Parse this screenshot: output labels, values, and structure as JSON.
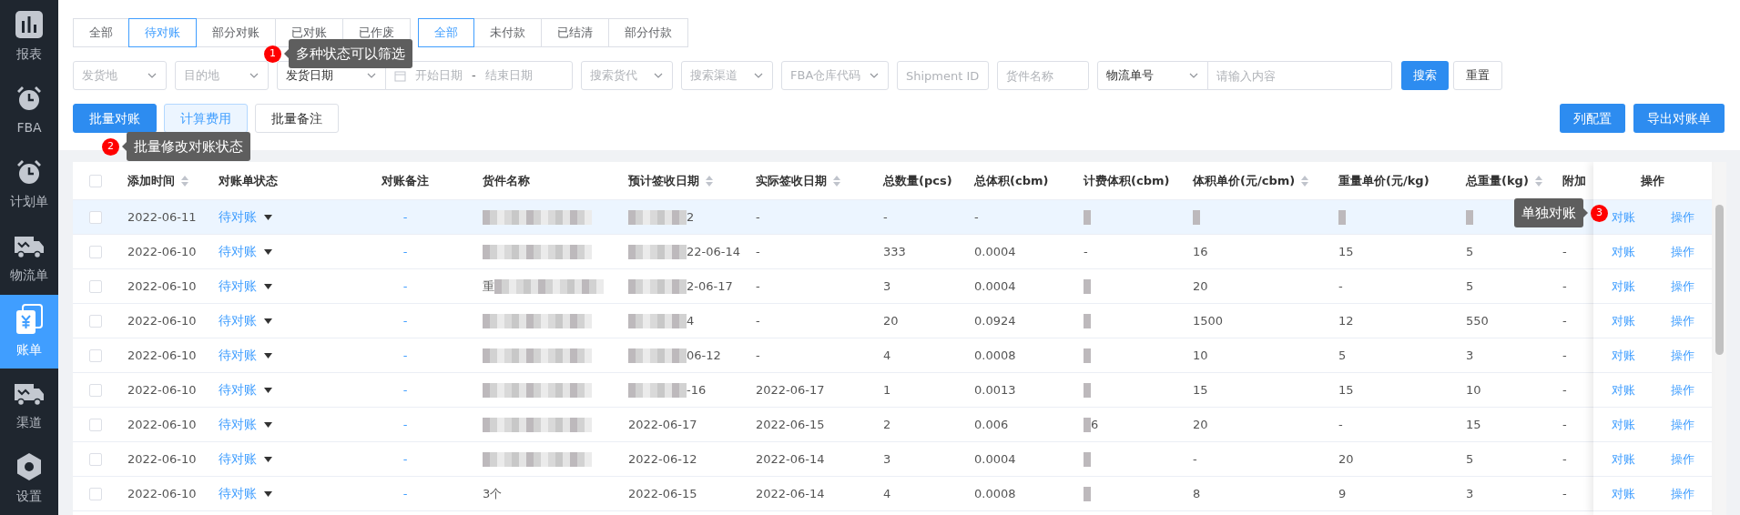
{
  "sidebar": {
    "items": [
      {
        "label": "报表",
        "kind": "chart",
        "selected": false
      },
      {
        "label": "FBA",
        "kind": "clock",
        "selected": false
      },
      {
        "label": "计划单",
        "kind": "clock",
        "selected": false
      },
      {
        "label": "物流单",
        "kind": "truck",
        "selected": false
      },
      {
        "label": "账单",
        "kind": "bill",
        "selected": true
      },
      {
        "label": "渠道",
        "kind": "truck",
        "selected": false
      },
      {
        "label": "设置",
        "kind": "hexagon",
        "selected": false
      }
    ]
  },
  "status_tabs": [
    {
      "label": "全部",
      "selected": false
    },
    {
      "label": "待对账",
      "selected": true
    },
    {
      "label": "部分对账",
      "selected": false
    },
    {
      "label": "已对账",
      "selected": false
    },
    {
      "label": "已作废",
      "selected": false
    }
  ],
  "payment_tabs": [
    {
      "label": "全部",
      "selected": true
    },
    {
      "label": "未付款",
      "selected": false
    },
    {
      "label": "已结清",
      "selected": false
    },
    {
      "label": "部分付款",
      "selected": false
    }
  ],
  "filters": {
    "origin": {
      "placeholder": "发货地"
    },
    "destination": {
      "placeholder": "目的地"
    },
    "date_type": {
      "value": "发货日期"
    },
    "date_range": {
      "start_placeholder": "开始日期",
      "separator": "-",
      "end_placeholder": "结束日期"
    },
    "forwarder": {
      "placeholder": "搜索货代"
    },
    "channel": {
      "placeholder": "搜索渠道"
    },
    "fba_code": {
      "placeholder": "FBA仓库代码"
    },
    "shipment_id": {
      "placeholder": "Shipment ID"
    },
    "cargo_name": {
      "placeholder": "货件名称"
    },
    "tracking": {
      "type_value": "物流单号",
      "placeholder": "请输入内容"
    },
    "search_button": "搜索",
    "reset_button": "重置"
  },
  "actions": [
    {
      "label": "批量对账",
      "kind": "primary"
    },
    {
      "label": "计算费用",
      "kind": "light"
    },
    {
      "label": "批量备注",
      "kind": "default"
    }
  ],
  "right_actions": [
    "列配置",
    "导出对账单"
  ],
  "table": {
    "select_all": {
      "checked": false
    },
    "columns": [
      {
        "label": "添加时间",
        "sortable": true
      },
      {
        "label": "对账单状态",
        "sortable": false
      },
      {
        "label": "对账备注",
        "sortable": false
      },
      {
        "label": "货件名称",
        "sortable": false
      },
      {
        "label": "预计签收日期",
        "sortable": true
      },
      {
        "label": "实际签收日期",
        "sortable": true
      },
      {
        "label": "总数量(pcs)",
        "sortable": false
      },
      {
        "label": "总体积(cbm)",
        "sortable": false
      },
      {
        "label": "计费体积(cbm)",
        "sortable": false
      },
      {
        "label": "体积单价(元/cbm)",
        "sortable": true
      },
      {
        "label": "重量单价(元/kg)",
        "sortable": false
      },
      {
        "label": "总重量(kg)",
        "sortable": true
      },
      {
        "label": "附加",
        "sortable": false
      }
    ],
    "action_column": "操作",
    "rows": [
      {
        "checked": false,
        "highlighted": true,
        "added": "2022-06-11",
        "status": "待对账",
        "note": "-",
        "name": {
          "blurred": true
        },
        "expected": {
          "text": "2",
          "blurred": true
        },
        "actual": "-",
        "qty": "-",
        "volume": "-",
        "billed": {
          "blurred": true
        },
        "vol_price": {
          "blurred": true
        },
        "weight_price": {
          "blurred": true
        },
        "weight": {
          "blurred": true
        },
        "reconcile": "对账",
        "operate": "操作"
      },
      {
        "checked": false,
        "highlighted": false,
        "added": "2022-06-10",
        "status": "待对账",
        "note": "-",
        "name": {
          "blurred": true
        },
        "expected": {
          "text": "22-06-14",
          "blurred": true
        },
        "actual": "-",
        "qty": "333",
        "volume": "0.0004",
        "billed": "-",
        "vol_price": "16",
        "weight_price": "15",
        "weight": "5",
        "extra": "-",
        "reconcile": "对账",
        "operate": "操作"
      },
      {
        "checked": false,
        "highlighted": false,
        "added": "2022-06-10",
        "status": "待对账",
        "note": "-",
        "name": {
          "text": "重",
          "blurred": true
        },
        "expected": {
          "text": "2-06-17",
          "blurred": true
        },
        "actual": "-",
        "qty": "3",
        "volume": "0.0004",
        "billed": {
          "blurred": true
        },
        "vol_price": "20",
        "weight_price": "-",
        "weight": "5",
        "extra": "-",
        "reconcile": "对账",
        "operate": "操作"
      },
      {
        "checked": false,
        "highlighted": false,
        "added": "2022-06-10",
        "status": "待对账",
        "note": "-",
        "name": {
          "blurred": true
        },
        "expected": {
          "text": "4",
          "blurred": true
        },
        "actual": "-",
        "qty": "20",
        "volume": "0.0924",
        "billed": {
          "blurred": true
        },
        "vol_price": "1500",
        "weight_price": "12",
        "weight": "550",
        "extra": "-",
        "reconcile": "对账",
        "operate": "操作"
      },
      {
        "checked": false,
        "highlighted": false,
        "added": "2022-06-10",
        "status": "待对账",
        "note": "-",
        "name": {
          "blurred": true
        },
        "expected": {
          "text": "06-12",
          "blurred": true
        },
        "actual": "-",
        "qty": "4",
        "volume": "0.0008",
        "billed": {
          "blurred": true
        },
        "vol_price": "10",
        "weight_price": "5",
        "weight": "3",
        "extra": "-",
        "reconcile": "对账",
        "operate": "操作"
      },
      {
        "checked": false,
        "highlighted": false,
        "added": "2022-06-10",
        "status": "待对账",
        "note": "-",
        "name": {
          "blurred": true
        },
        "expected": {
          "text": "-16",
          "blurred": true
        },
        "actual": "2022-06-17",
        "qty": "1",
        "volume": "0.0013",
        "billed": {
          "blurred": true
        },
        "vol_price": "15",
        "weight_price": "15",
        "weight": "10",
        "extra": "-",
        "reconcile": "对账",
        "operate": "操作"
      },
      {
        "checked": false,
        "highlighted": false,
        "added": "2022-06-10",
        "status": "待对账",
        "note": "-",
        "name": {
          "blurred": true
        },
        "expected": "2022-06-17",
        "actual": "2022-06-15",
        "qty": "2",
        "volume": "0.006",
        "billed": {
          "text": "6",
          "blurred": true
        },
        "vol_price": "20",
        "weight_price": "-",
        "weight": "15",
        "extra": "-",
        "reconcile": "对账",
        "operate": "操作"
      },
      {
        "checked": false,
        "highlighted": false,
        "added": "2022-06-10",
        "status": "待对账",
        "note": "-",
        "name": {
          "blurred": true
        },
        "expected": "2022-06-12",
        "actual": "2022-06-14",
        "qty": "3",
        "volume": "0.0004",
        "billed": {
          "blurred": true
        },
        "vol_price": "-",
        "weight_price": "20",
        "weight": "5",
        "extra": "-",
        "reconcile": "对账",
        "operate": "操作"
      },
      {
        "checked": false,
        "highlighted": false,
        "added": "2022-06-10",
        "status": "待对账",
        "note": "-",
        "name": "3个",
        "expected": "2022-06-15",
        "actual": "2022-06-14",
        "qty": "4",
        "volume": "0.0008",
        "billed": {
          "blurred": true
        },
        "vol_price": "8",
        "weight_price": "9",
        "weight": "3",
        "extra": "-",
        "reconcile": "对账",
        "operate": "操作"
      }
    ]
  },
  "callouts": [
    {
      "number": "1",
      "text": "多种状态可以筛选"
    },
    {
      "number": "2",
      "text": "批量修改对账状态"
    },
    {
      "number": "3",
      "text": "单独对账"
    }
  ]
}
